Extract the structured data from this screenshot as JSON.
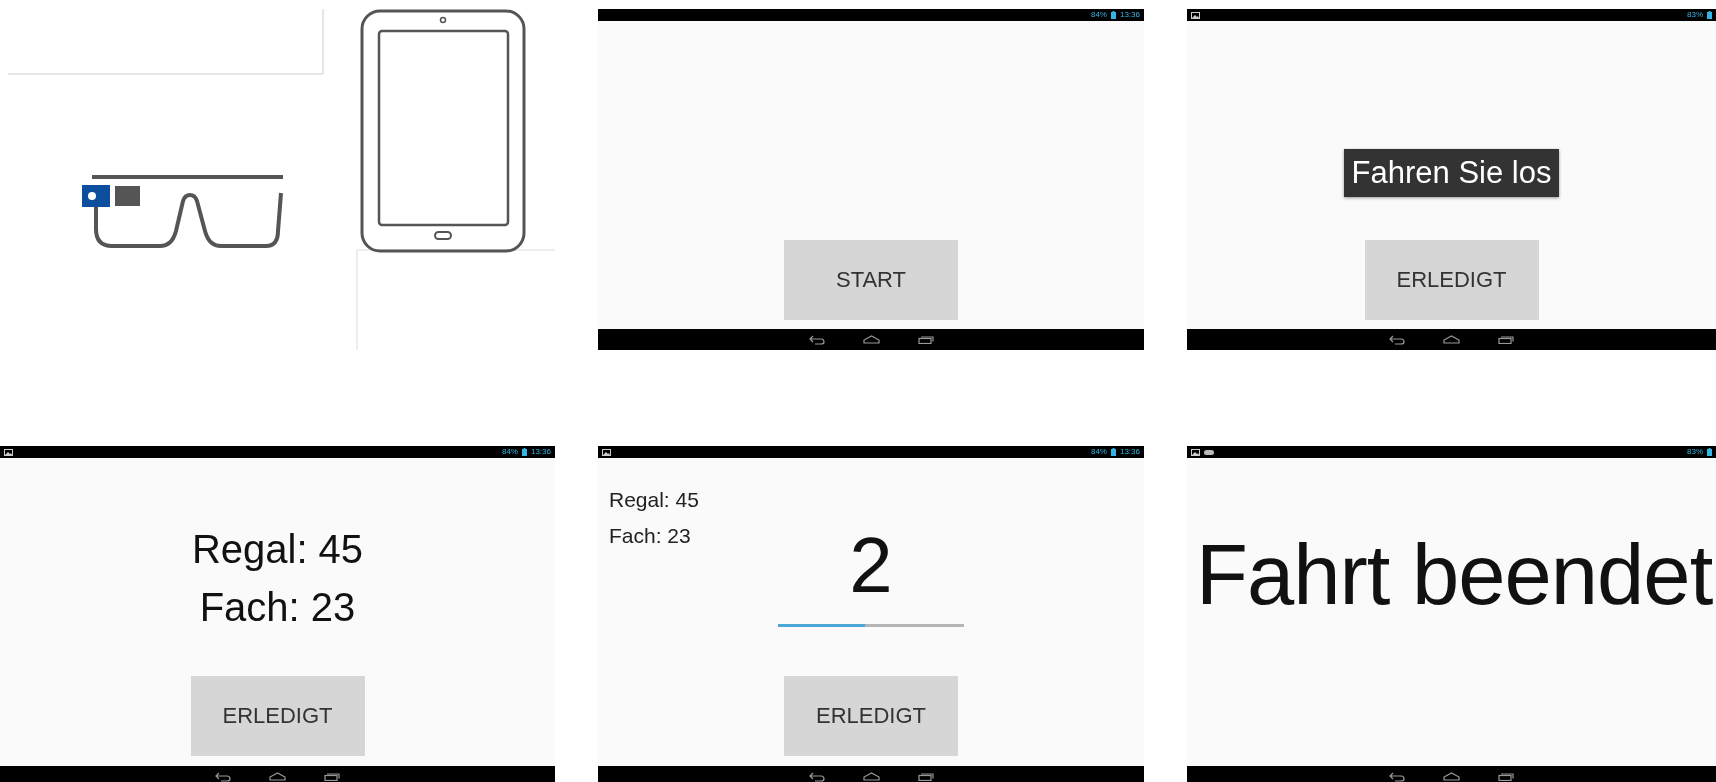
{
  "panels": [
    {
      "kind": "devices"
    },
    {
      "kind": "screen",
      "status": {
        "picture_notification": false,
        "extra_notification": false,
        "battery": "84%",
        "time": "13:36"
      },
      "content": {
        "kind": "start",
        "button": "START"
      }
    },
    {
      "kind": "screen",
      "status": {
        "picture_notification": true,
        "extra_notification": false,
        "battery": "83%"
      },
      "content": {
        "kind": "toast",
        "message": "Fahren Sie los",
        "button": "ERLEDIGT"
      }
    },
    {
      "kind": "screen",
      "status": {
        "picture_notification": true,
        "extra_notification": false,
        "battery": "84%",
        "time": "13:36"
      },
      "content": {
        "kind": "location",
        "lines": [
          "Regal: 45",
          "Fach: 23"
        ],
        "button": "ERLEDIGT"
      }
    },
    {
      "kind": "screen",
      "status": {
        "picture_notification": true,
        "extra_notification": false,
        "battery": "84%",
        "time": "13:36"
      },
      "content": {
        "kind": "countdown",
        "lines": [
          "Regal: 45",
          "Fach: 23"
        ],
        "count": "2",
        "level": 0.47,
        "button": "ERLEDIGT"
      }
    },
    {
      "kind": "screen",
      "status": {
        "picture_notification": true,
        "extra_notification": true,
        "battery": "83%"
      },
      "content": {
        "kind": "finished",
        "message": "Fahrt beendet"
      }
    }
  ]
}
